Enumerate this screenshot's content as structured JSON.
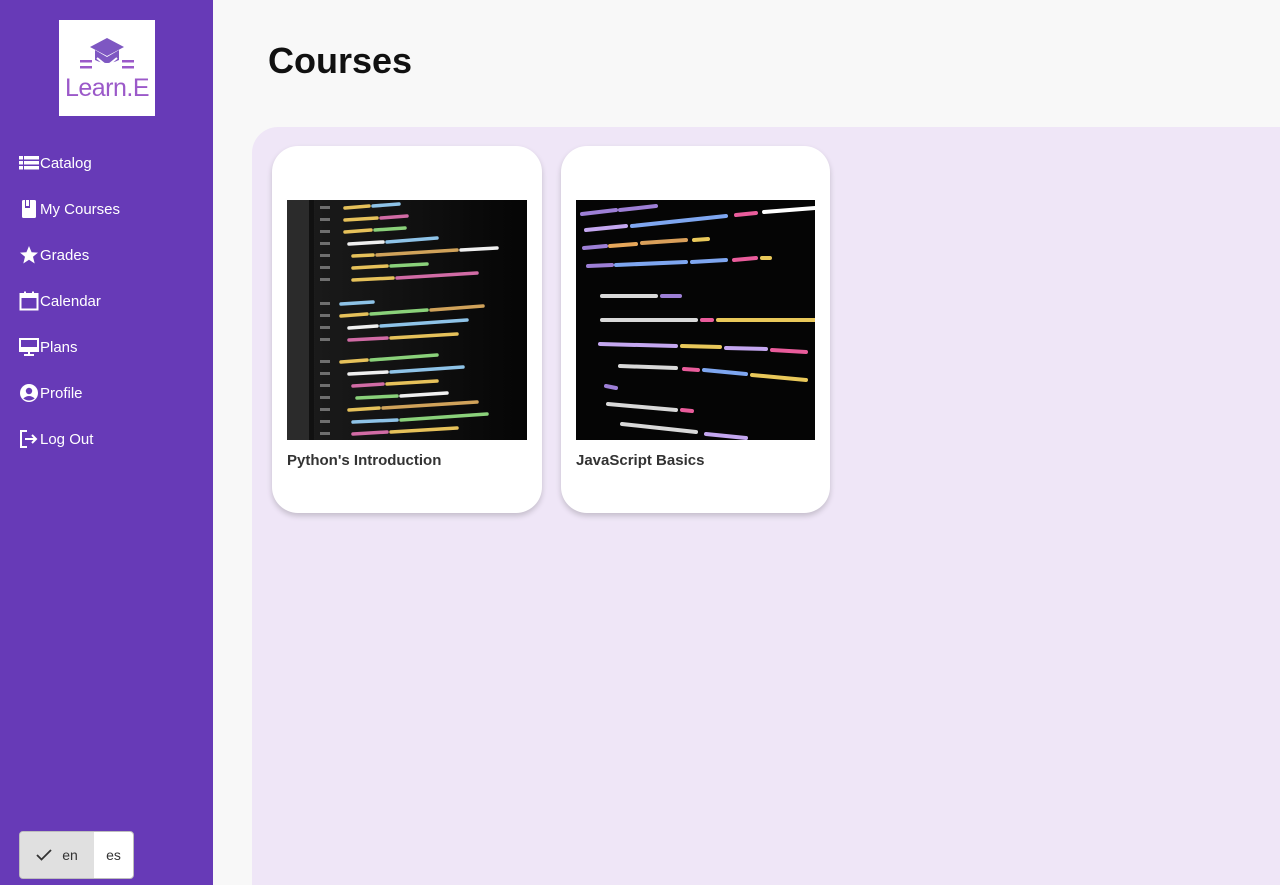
{
  "app": {
    "logo_text": "Learn.E"
  },
  "sidebar": {
    "items": [
      {
        "label": "Catalog",
        "icon": "list-icon"
      },
      {
        "label": "My Courses",
        "icon": "book-icon"
      },
      {
        "label": "Grades",
        "icon": "star-icon"
      },
      {
        "label": "Calendar",
        "icon": "calendar-icon"
      },
      {
        "label": "Plans",
        "icon": "presentation-icon"
      },
      {
        "label": "Profile",
        "icon": "user-circle-icon"
      },
      {
        "label": "Log Out",
        "icon": "logout-icon"
      }
    ]
  },
  "language": {
    "options": [
      "en",
      "es"
    ],
    "selected": "en"
  },
  "main": {
    "title": "Courses",
    "courses": [
      {
        "title": "Python's Introduction",
        "image": "python-code-screen"
      },
      {
        "title": "JavaScript Basics",
        "image": "javascript-code-screen"
      }
    ]
  },
  "colors": {
    "sidebar_bg": "#673ab7",
    "content_bg": "#efe6f7",
    "logo_accent": "#9b59c9"
  }
}
